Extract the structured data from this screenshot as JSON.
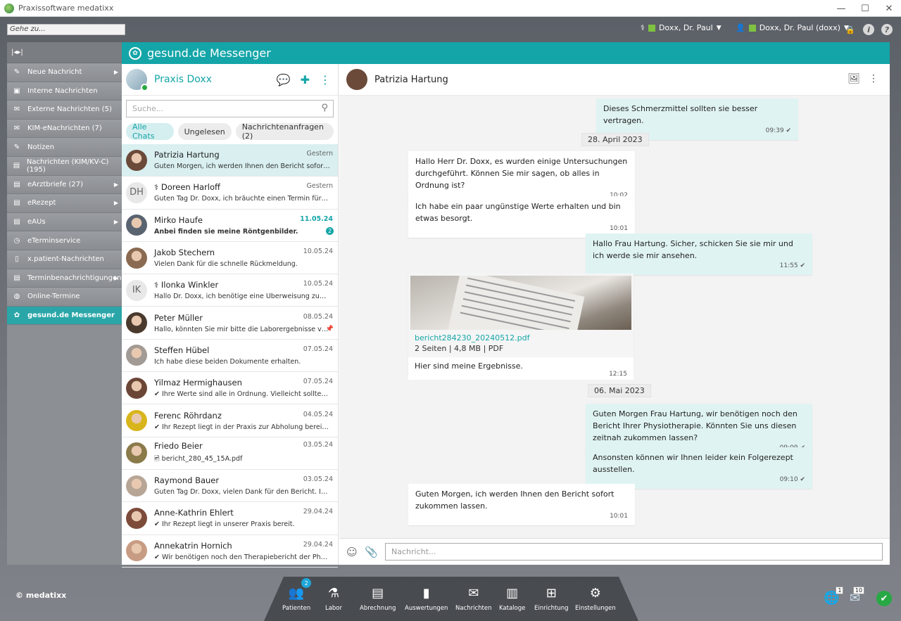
{
  "window": {
    "title": "Praxissoftware medatixx"
  },
  "topbar": {
    "goto_placeholder": "Gehe zu...",
    "user_primary": "Doxx, Dr. Paul",
    "user_secondary": "Doxx, Dr. Paul (doxx)"
  },
  "sidebar": {
    "items": [
      {
        "label": "Neue Nachricht",
        "icon": "edit-icon",
        "arrow": true
      },
      {
        "label": "Interne Nachrichten",
        "icon": "inbox-icon",
        "arrow": false
      },
      {
        "label": "Externe Nachrichten (5)",
        "icon": "mail-icon",
        "arrow": false
      },
      {
        "label": "KIM-eNachrichten (7)",
        "icon": "kim-mail-icon",
        "arrow": false
      },
      {
        "label": "Notizen",
        "icon": "note-icon",
        "arrow": false
      },
      {
        "label": "Nachrichten (KIM/KV-C) (195)",
        "icon": "kim-kvc-icon",
        "arrow": false
      },
      {
        "label": "eArztbriefe (27)",
        "icon": "letter-icon",
        "arrow": true
      },
      {
        "label": "eRezept",
        "icon": "prescription-icon",
        "arrow": true
      },
      {
        "label": "eAUs",
        "icon": "eau-icon",
        "arrow": true
      },
      {
        "label": "eTerminservice",
        "icon": "calendar-icon",
        "arrow": false
      },
      {
        "label": "x.patient-Nachrichten",
        "icon": "phone-icon",
        "arrow": false
      },
      {
        "label": "Terminbenachrichtigungen",
        "icon": "bell-icon",
        "arrow": true
      },
      {
        "label": "Online-Termine",
        "icon": "globe-icon",
        "arrow": false
      },
      {
        "label": "gesund.de Messenger",
        "icon": "gesund-icon",
        "arrow": false,
        "active": true
      }
    ]
  },
  "header": {
    "title": "gesund.de Messenger"
  },
  "chatlist": {
    "praxis_name": "Praxis Doxx",
    "search_placeholder": "Suche...",
    "filters": [
      "Alle Chats",
      "Ungelesen",
      "Nachrichtenanfragen (2)"
    ],
    "chats": [
      {
        "name": "Patrizia Hartung",
        "date": "Gestern",
        "message": "Guten Morgen, ich werden Ihnen den Bericht sofort zukommen lassen.",
        "avatar_color": "#6b4a3a",
        "selected": true
      },
      {
        "name": "Doreen Harloff",
        "date": "Gestern",
        "message": "Guten Tag Dr. Doxx, ich bräuchte einen Termin für ein großes Blutbild.",
        "initials": "DH",
        "request": true
      },
      {
        "name": "Mirko Haufe",
        "date": "11.05.24",
        "message": "Anbei finden sie meine Röntgenbilder.",
        "avatar_color": "#5a6470",
        "unread": "2"
      },
      {
        "name": "Jakob Stechern",
        "date": "10.05.24",
        "message": "Vielen Dank für die schnelle Rückmeldung.",
        "avatar_color": "#8a6a50"
      },
      {
        "name": "Ilonka Winkler",
        "date": "10.05.24",
        "message": "Hallo Dr. Doxx, ich benötige eine Überweisung zum Neurologen.",
        "initials": "IK",
        "request": true
      },
      {
        "name": "Peter Müller",
        "date": "08.05.24",
        "message": "Hallo, könnten Sie mir bitte die Laborergebnisse von meiner Frau schicken?",
        "avatar_color": "#4a3a2e",
        "pinned": true
      },
      {
        "name": "Steffen Hübel",
        "date": "07.05.24",
        "message": "Ich habe diese beiden Dokumente erhalten.",
        "avatar_color": "#a29a94"
      },
      {
        "name": "Yilmaz Hermighausen",
        "date": "07.05.24",
        "message": "✔ Ihre Werte sind alle in Ordnung. Vielleicht sollten Sie etwas mehr Sport treiben.",
        "avatar_color": "#6b4636"
      },
      {
        "name": "Ferenc Röhrdanz",
        "date": "04.05.24",
        "message": "✔ Ihr Rezept liegt in der Praxis zur Abholung bereit. Die Öffnungszeiten finden Sie hier.",
        "avatar_color": "#d9b51c"
      },
      {
        "name": "Friedo Beier",
        "date": "03.05.24",
        "message": "🖻 bericht_280_45_15A.pdf",
        "avatar_color": "#8b7a4a"
      },
      {
        "name": "Raymond Bauer",
        "date": "03.05.24",
        "message": "Guten Tag Dr. Doxx, vielen Dank für den Bericht. Ich werde ihn mir genau ansehen.",
        "avatar_color": "#b7a596"
      },
      {
        "name": "Anne-Kathrin Ehlert",
        "date": "29.04.24",
        "message": "✔ Ihr Rezept liegt in unserer Praxis bereit.",
        "avatar_color": "#7d4b3a"
      },
      {
        "name": "Annekatrin Hornich",
        "date": "29.04.24",
        "message": "✔ Wir benötigen noch den Therapiebericht der Physiotherapie.",
        "avatar_color": "#c89c84"
      }
    ]
  },
  "conversation": {
    "contact_name": "Patrizia Hartung",
    "composer_placeholder": "Nachricht...",
    "messages": [
      {
        "text": "Dieses Schmerzmittel sollten sie besser vertragen.",
        "time": "09:39 ✔",
        "dir": "out"
      },
      {
        "date": "28. April 2023"
      },
      {
        "text": "Hallo Herr Dr. Doxx, es wurden einige Untersuchungen durchgeführt. Können Sie mir sagen, ob alles in Ordnung ist?",
        "time": "10:02",
        "dir": "in"
      },
      {
        "text": "Ich habe ein paar ungünstige Werte erhalten und bin etwas besorgt.",
        "time": "10:01",
        "dir": "in"
      },
      {
        "text": "Hallo Frau Hartung. Sicher, schicken Sie sie mir und ich werde sie mir ansehen.",
        "time": "11:55 ✔",
        "dir": "out"
      },
      {
        "file_name": "bericht284230_20240512.pdf",
        "file_meta": "2 Seiten | 4,8 MB | PDF",
        "text": "Hier sind meine Ergebnisse.",
        "time": "12:15",
        "dir": "in"
      },
      {
        "date": "06. Mai 2023"
      },
      {
        "text": "Guten Morgen Frau Hartung, wir benötigen noch den Bericht Ihrer Physiotherapie. Könnten Sie uns diesen zeitnah zukommen lassen?",
        "time": "09:09 ✔",
        "dir": "out"
      },
      {
        "text": "Ansonsten können wir Ihnen leider kein Folgerezept ausstellen.",
        "time": "09:10 ✔",
        "dir": "out"
      },
      {
        "text": "Guten Morgen, ich werden Ihnen den Bericht sofort zukommen lassen.",
        "time": "10:01",
        "dir": "in"
      }
    ]
  },
  "footer": {
    "copyright": "© medatixx",
    "dock": [
      {
        "label": "Patienten",
        "icon": "patients-icon",
        "badge": "2"
      },
      {
        "label": "Labor",
        "icon": "lab-icon"
      },
      {
        "label": "Abrechnung",
        "icon": "billing-icon"
      },
      {
        "label": "Auswertungen",
        "icon": "chart-icon"
      },
      {
        "label": "Nachrichten",
        "icon": "mail-icon"
      },
      {
        "label": "Kataloge",
        "icon": "books-icon"
      },
      {
        "label": "Einrichtung",
        "icon": "network-icon"
      },
      {
        "label": "Einstellungen",
        "icon": "gear-icon"
      }
    ],
    "tray": {
      "globe_badge": "1",
      "mail_badge": "10"
    }
  },
  "colors": {
    "accent": "#14a5a8",
    "sidebar": "#8c8f93",
    "outgoing": "#e0f3f3"
  }
}
